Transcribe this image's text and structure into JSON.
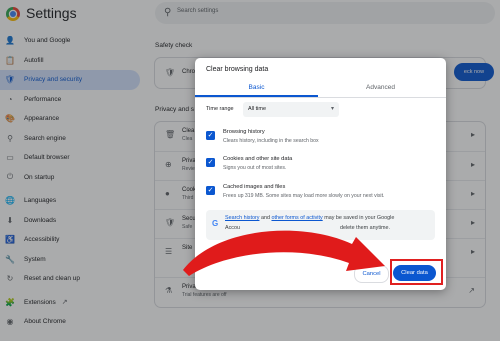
{
  "app": {
    "title": "Settings"
  },
  "search": {
    "placeholder": "Search settings"
  },
  "sidebar": {
    "items": [
      {
        "label": "You and Google",
        "icon": "person-icon"
      },
      {
        "label": "Autofill",
        "icon": "autofill-icon"
      },
      {
        "label": "Privacy and security",
        "icon": "shield-icon",
        "active": true
      },
      {
        "label": "Performance",
        "icon": "performance-icon"
      },
      {
        "label": "Appearance",
        "icon": "palette-icon"
      },
      {
        "label": "Search engine",
        "icon": "search-icon"
      },
      {
        "label": "Default browser",
        "icon": "browser-icon"
      },
      {
        "label": "On startup",
        "icon": "power-icon"
      },
      {
        "label": "Languages",
        "icon": "globe-icon"
      },
      {
        "label": "Downloads",
        "icon": "download-icon"
      },
      {
        "label": "Accessibility",
        "icon": "accessibility-icon"
      },
      {
        "label": "System",
        "icon": "wrench-icon"
      },
      {
        "label": "Reset and clean up",
        "icon": "reset-icon"
      },
      {
        "label": "Extensions",
        "icon": "puzzle-icon"
      },
      {
        "label": "About Chrome",
        "icon": "chrome-icon"
      }
    ]
  },
  "main": {
    "safety_check": {
      "heading": "Safety check",
      "row_text": "Chro",
      "button": "eck now"
    },
    "privacy": {
      "heading": "Privacy and s",
      "rows": [
        {
          "title": "Clea",
          "sub": "Clea"
        },
        {
          "title": "Priva",
          "sub": "Revie"
        },
        {
          "title": "Cook",
          "sub": "Third"
        },
        {
          "title": "Secu",
          "sub": "Safe"
        },
        {
          "title": "Site",
          "sub": ""
        },
        {
          "title": "Privacy Sandbox",
          "sub": "Trial features are off"
        }
      ]
    }
  },
  "dialog": {
    "title": "Clear browsing data",
    "tabs": [
      "Basic",
      "Advanced"
    ],
    "time_range": {
      "label": "Time range",
      "value": "All time"
    },
    "options": [
      {
        "title": "Browsing history",
        "sub": "Clears history, including in the search box",
        "checked": true
      },
      {
        "title": "Cookies and other site data",
        "sub": "Signs you out of most sites.",
        "checked": true
      },
      {
        "title": "Cached images and files",
        "sub": "Frees up 319 MB. Some sites may load more slowly on your next visit.",
        "checked": true
      }
    ],
    "google_note": {
      "link1": "Search history",
      "mid": " and ",
      "link2": "other forms of activity",
      "rest1": " may be saved in your Google",
      "line2_start": "Accou",
      "line2_end": "delete them anytime."
    },
    "buttons": {
      "cancel": "Cancel",
      "clear": "Clear data"
    }
  },
  "colors": {
    "accent": "#0b57d0",
    "highlight": "#e02020",
    "arrow": "#e01b1b"
  }
}
